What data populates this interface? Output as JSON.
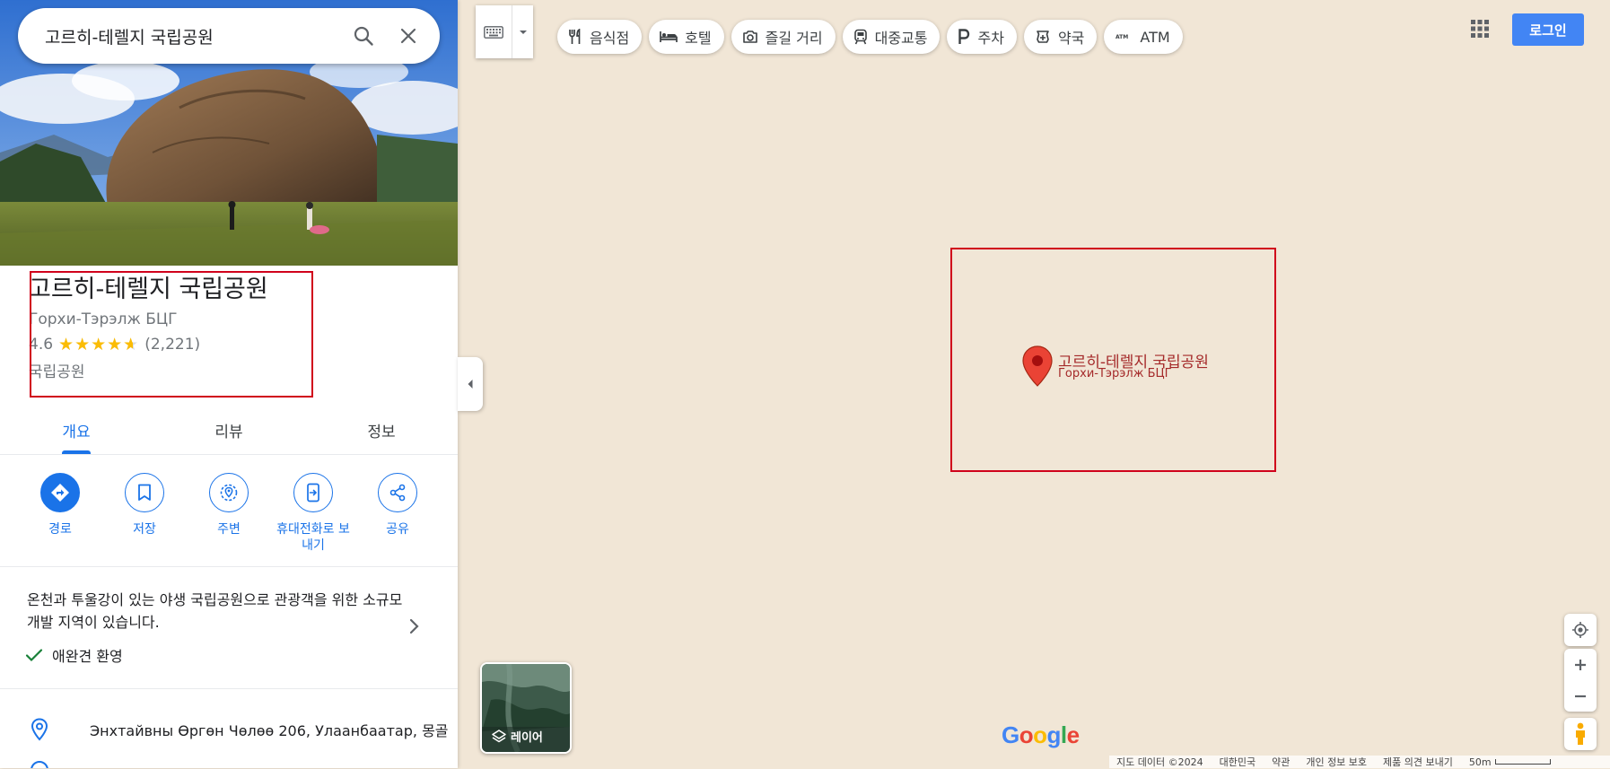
{
  "search": {
    "query": "고르히-테렐지 국립공원"
  },
  "place": {
    "title": "고르히-테렐지 국립공원",
    "subtitle": "Горхи-Тэрэлж БЦГ",
    "rating": "4.6",
    "rating_fraction": 0.92,
    "review_count": "(2,221)",
    "category": "국립공원"
  },
  "tabs": [
    {
      "label": "개요",
      "active": true
    },
    {
      "label": "리뷰",
      "active": false
    },
    {
      "label": "정보",
      "active": false
    }
  ],
  "actions": [
    {
      "label": "경로",
      "icon": "directions-icon"
    },
    {
      "label": "저장",
      "icon": "bookmark-icon"
    },
    {
      "label": "주변",
      "icon": "nearby-icon"
    },
    {
      "label": "휴대전화로 보내기",
      "icon": "send-to-phone-icon"
    },
    {
      "label": "공유",
      "icon": "share-icon"
    }
  ],
  "description": {
    "text": "온천과 투울강이 있는 야생 국립공원으로 관광객을 위한 소규모 개발 지역이 있습니다.",
    "feature": "애완견 환영"
  },
  "address": "Энхтайвны Өргөн Чөлөө 206, Улаанбаатар, 몽골",
  "chips": [
    {
      "label": "음식점",
      "icon": "restaurant-icon"
    },
    {
      "label": "호텔",
      "icon": "hotel-icon"
    },
    {
      "label": "즐길 거리",
      "icon": "camera-icon"
    },
    {
      "label": "대중교통",
      "icon": "transit-icon"
    },
    {
      "label": "주차",
      "icon": "parking-icon"
    },
    {
      "label": "약국",
      "icon": "pharmacy-icon"
    },
    {
      "label": "ATM",
      "icon": "atm-icon"
    }
  ],
  "header": {
    "login_label": "로그인"
  },
  "map": {
    "pin_label": "고르히-테렐지 국립공원",
    "pin_sublabel": "Горхи-Тэрэлж БЦГ",
    "layers_label": "레이어",
    "logo_text": "Google"
  },
  "footer": {
    "items": [
      "지도 데이터 ©2024",
      "대한민국",
      "약관",
      "개인 정보 보호",
      "제품 의견 보내기"
    ],
    "scale": "50m"
  },
  "colors": {
    "accent": "#1a73e8",
    "login": "#4285f4",
    "star": "#fbbc04",
    "pin": "#ea4335",
    "highlight": "#d0021b",
    "map_bg": "#f1e6d6"
  }
}
